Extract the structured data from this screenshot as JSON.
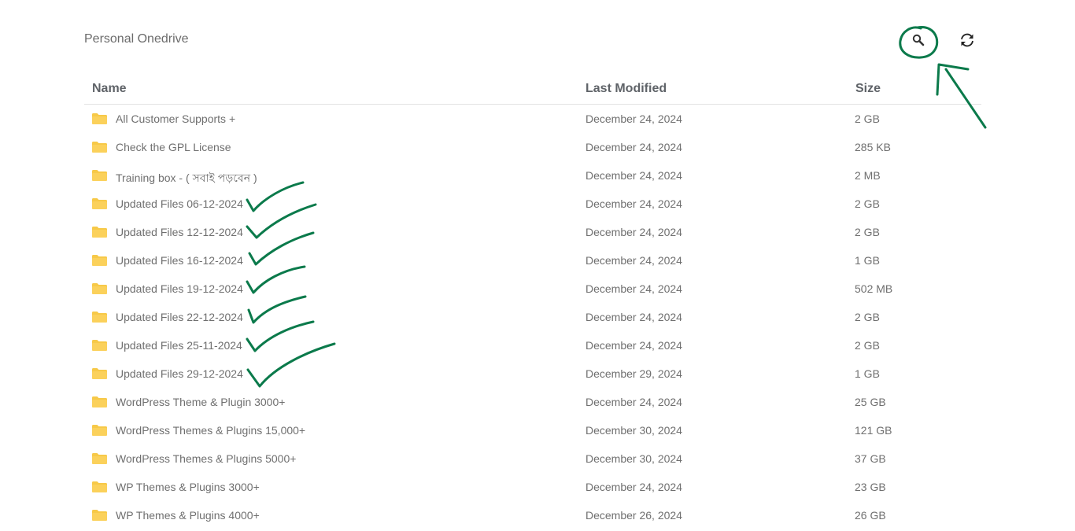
{
  "header": {
    "title": "Personal Onedrive",
    "search_icon": "search-icon",
    "refresh_icon": "refresh-icon"
  },
  "columns": {
    "name": "Name",
    "modified": "Last Modified",
    "size": "Size"
  },
  "colors": {
    "folder": "#f7c948",
    "annotation": "#0b7a4b"
  },
  "files": [
    {
      "name": "All Customer Supports +",
      "modified": "December 24, 2024",
      "size": "2 GB"
    },
    {
      "name": "Check the GPL License",
      "modified": "December 24, 2024",
      "size": "285 KB"
    },
    {
      "name": "Training box - ( সবাই পড়বেন )",
      "modified": "December 24, 2024",
      "size": "2 MB"
    },
    {
      "name": "Updated Files 06-12-2024",
      "modified": "December 24, 2024",
      "size": "2 GB"
    },
    {
      "name": "Updated Files 12-12-2024",
      "modified": "December 24, 2024",
      "size": "2 GB"
    },
    {
      "name": "Updated Files 16-12-2024",
      "modified": "December 24, 2024",
      "size": "1 GB"
    },
    {
      "name": "Updated Files 19-12-2024",
      "modified": "December 24, 2024",
      "size": "502 MB"
    },
    {
      "name": "Updated Files 22-12-2024",
      "modified": "December 24, 2024",
      "size": "2 GB"
    },
    {
      "name": "Updated Files 25-11-2024",
      "modified": "December 24, 2024",
      "size": "2 GB"
    },
    {
      "name": "Updated Files 29-12-2024",
      "modified": "December 29, 2024",
      "size": "1 GB"
    },
    {
      "name": "WordPress Theme & Plugin 3000+",
      "modified": "December 24, 2024",
      "size": "25 GB"
    },
    {
      "name": "WordPress Themes & Plugins 15,000+",
      "modified": "December 30, 2024",
      "size": "121 GB"
    },
    {
      "name": "WordPress Themes & Plugins 5000+",
      "modified": "December 30, 2024",
      "size": "37 GB"
    },
    {
      "name": "WP Themes & Plugins 3000+",
      "modified": "December 24, 2024",
      "size": "23 GB"
    },
    {
      "name": "WP Themes & Plugins 4000+",
      "modified": "December 26, 2024",
      "size": "26 GB"
    }
  ]
}
